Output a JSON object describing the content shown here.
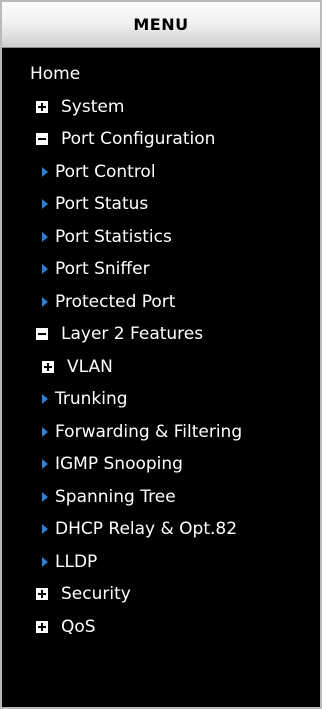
{
  "menu": {
    "title": "MENU",
    "items": [
      {
        "label": "Home",
        "level": 0,
        "icon": "none",
        "name": "home"
      },
      {
        "label": "System",
        "level": 1,
        "icon": "plus-box-icon",
        "name": "system"
      },
      {
        "label": "Port Configuration",
        "level": 1,
        "icon": "minus-box-icon",
        "name": "port-configuration"
      },
      {
        "label": "Port Control",
        "level": 2,
        "icon": "arrow-right-icon",
        "name": "port-control"
      },
      {
        "label": "Port Status",
        "level": 2,
        "icon": "arrow-right-icon",
        "name": "port-status"
      },
      {
        "label": "Port Statistics",
        "level": 2,
        "icon": "arrow-right-icon",
        "name": "port-statistics"
      },
      {
        "label": "Port Sniffer",
        "level": 2,
        "icon": "arrow-right-icon",
        "name": "port-sniffer"
      },
      {
        "label": "Protected Port",
        "level": 2,
        "icon": "arrow-right-icon",
        "name": "protected-port"
      },
      {
        "label": "Layer 2 Features",
        "level": 1,
        "icon": "minus-box-icon",
        "name": "layer-2-features"
      },
      {
        "label": "VLAN",
        "level": 2,
        "icon": "plus-box-icon",
        "name": "vlan"
      },
      {
        "label": "Trunking",
        "level": 2,
        "icon": "arrow-right-icon",
        "name": "trunking"
      },
      {
        "label": "Forwarding & Filtering",
        "level": 2,
        "icon": "arrow-right-icon",
        "name": "forwarding-filtering"
      },
      {
        "label": "IGMP Snooping",
        "level": 2,
        "icon": "arrow-right-icon",
        "name": "igmp-snooping"
      },
      {
        "label": "Spanning Tree",
        "level": 2,
        "icon": "arrow-right-icon",
        "name": "spanning-tree"
      },
      {
        "label": "DHCP Relay & Opt.82",
        "level": 2,
        "icon": "arrow-right-icon",
        "name": "dhcp-relay-opt82"
      },
      {
        "label": "LLDP",
        "level": 2,
        "icon": "arrow-right-icon",
        "name": "lldp"
      },
      {
        "label": "Security",
        "level": 1,
        "icon": "plus-box-icon",
        "name": "security"
      },
      {
        "label": "QoS",
        "level": 1,
        "icon": "plus-box-icon",
        "name": "qos"
      }
    ]
  },
  "colors": {
    "background": "#000000",
    "text": "#ffffff",
    "arrow": "#2f7fd3",
    "header_text": "#000000"
  }
}
